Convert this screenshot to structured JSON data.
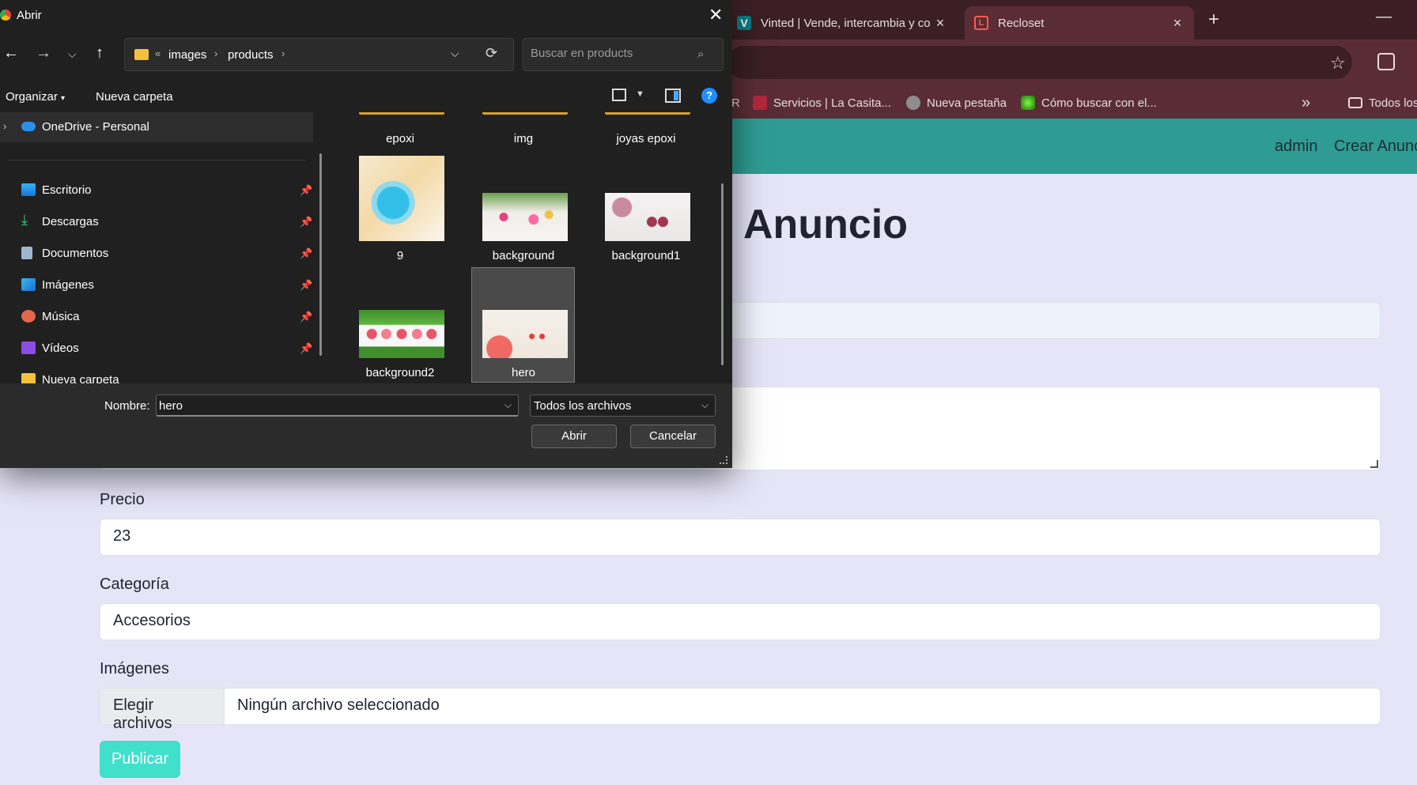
{
  "browser": {
    "tabs": [
      {
        "title": "Vinted | Vende, intercambia y co",
        "icon": "vinted-icon"
      },
      {
        "title": "Recloset",
        "icon": "laravel-icon"
      }
    ],
    "bookmarks": [
      {
        "label": "Servicios | La Casita..."
      },
      {
        "label": "Nueva pestaña"
      },
      {
        "label": "Cómo buscar con el..."
      },
      {
        "label": "Todos los"
      }
    ],
    "bookmarks_partial": "R",
    "overflow_label": "»"
  },
  "site": {
    "nav": {
      "admin": "admin",
      "create": "Crear Anunc"
    },
    "page_title": "Anuncio",
    "price_label": "Precio",
    "price_value": "23",
    "category_label": "Categoría",
    "category_value": "Accesorios",
    "images_label": "Imágenes",
    "file_button": "Elegir archivos",
    "file_status": "Ningún archivo seleccionado",
    "publish": "Publicar",
    "accent": "#40e0cc",
    "navbar_color": "#2f9c93"
  },
  "dialog": {
    "title": "Abrir",
    "breadcrumb": {
      "overflow": "«",
      "items": [
        "images",
        "products"
      ]
    },
    "search_placeholder": "Buscar en products",
    "toolbar": {
      "organize": "Organizar",
      "new_folder": "Nueva carpeta",
      "help": "?"
    },
    "sidebar": [
      {
        "label": "OneDrive - Personal",
        "icon": "cloud-icon"
      },
      {
        "label": "Escritorio",
        "icon": "desktop-icon"
      },
      {
        "label": "Descargas",
        "icon": "download-icon"
      },
      {
        "label": "Documentos",
        "icon": "document-icon"
      },
      {
        "label": "Imágenes",
        "icon": "pictures-icon"
      },
      {
        "label": "Música",
        "icon": "music-icon"
      },
      {
        "label": "Vídeos",
        "icon": "video-icon"
      },
      {
        "label": "Nueva carpeta",
        "icon": "folder-icon"
      }
    ],
    "folders": [
      "epoxi",
      "img",
      "joyas epoxi"
    ],
    "files": [
      "9",
      "background",
      "background1",
      "background2",
      "hero"
    ],
    "selected_file": "hero",
    "name_label": "Nombre:",
    "name_value": "hero",
    "file_type": "Todos los archivos",
    "open": "Abrir",
    "cancel": "Cancelar"
  }
}
